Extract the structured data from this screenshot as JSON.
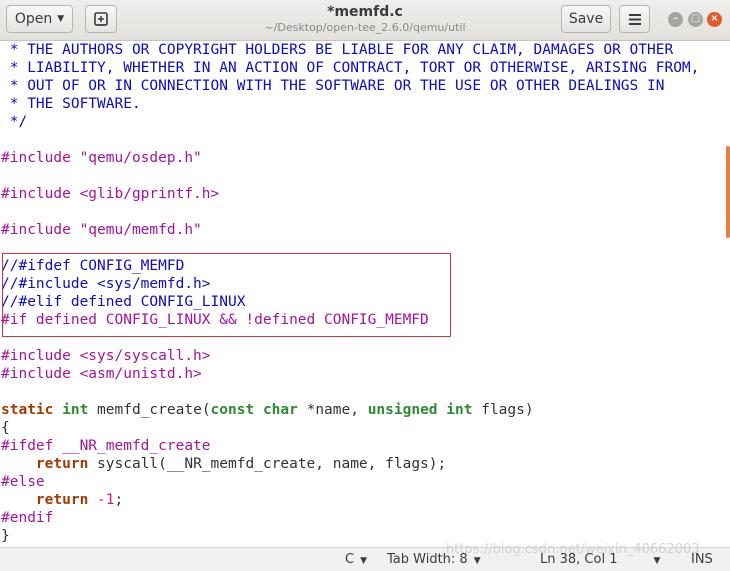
{
  "header": {
    "open_label": "Open",
    "title": "*memfd.c",
    "subtitle": "~/Desktop/open-tee_2.6.0/qemu/util",
    "save_label": "Save",
    "pin_icon": "new-document-icon",
    "menu_icon": "hamburger-menu-icon",
    "window_controls": [
      "minimize-icon",
      "maximize-icon",
      "close-icon"
    ]
  },
  "code": {
    "c1": " * THE AUTHORS OR COPYRIGHT HOLDERS BE LIABLE FOR ANY CLAIM, DAMAGES OR OTHER",
    "c2": " * LIABILITY, WHETHER IN AN ACTION OF CONTRACT, TORT OR OTHERWISE, ARISING FROM,",
    "c3": " * OUT OF OR IN CONNECTION WITH THE SOFTWARE OR THE USE OR OTHER DEALINGS IN",
    "c4": " * THE SOFTWARE.",
    "c5": " */",
    "inc1": "#include \"qemu/osdep.h\"",
    "inc2": "#include <glib/gprintf.h>",
    "inc3": "#include \"qemu/memfd.h\"",
    "cm1": "//#ifdef CONFIG_MEMFD",
    "cm2": "//#include <sys/memfd.h>",
    "cm3": "//#elif defined CONFIG_LINUX",
    "pp1": "#if defined CONFIG_LINUX && !defined CONFIG_MEMFD",
    "inc4": "#include <sys/syscall.h>",
    "inc5": "#include <asm/unistd.h>",
    "fn": {
      "kw_static": "static",
      "ty_int": "int",
      "name": " memfd_create(",
      "kw_const": "const",
      "ty_char": "char",
      "arg1": " *name, ",
      "ty_unsigned": "unsigned",
      "arg2": " flags)"
    },
    "brace_open": "{",
    "ifdef_line": "#ifdef __NR_memfd_create",
    "ret1_kw": "return",
    "ret1_rest": " syscall(__NR_memfd_create, name, flags);",
    "else_line": "#else",
    "ret2_kw": "return",
    "ret2_minus": " -1",
    "ret2_semi": ";",
    "endif_line": "#endif",
    "brace_close": "}"
  },
  "status": {
    "language": "C",
    "tab_width": "Tab Width: 8",
    "position": "Ln 38, Col 1",
    "mode": "INS",
    "watermark": "https://blog.csdn.net/weixin_40662003"
  },
  "colors": {
    "comment": "#0c0cc0",
    "preprocessor": "#a4139f",
    "keyword": "#a33b00",
    "type": "#2e8a2e",
    "highlight_border": "#d0363c",
    "scrollbar": "#e97c42",
    "close_button": "#e05a2b"
  }
}
